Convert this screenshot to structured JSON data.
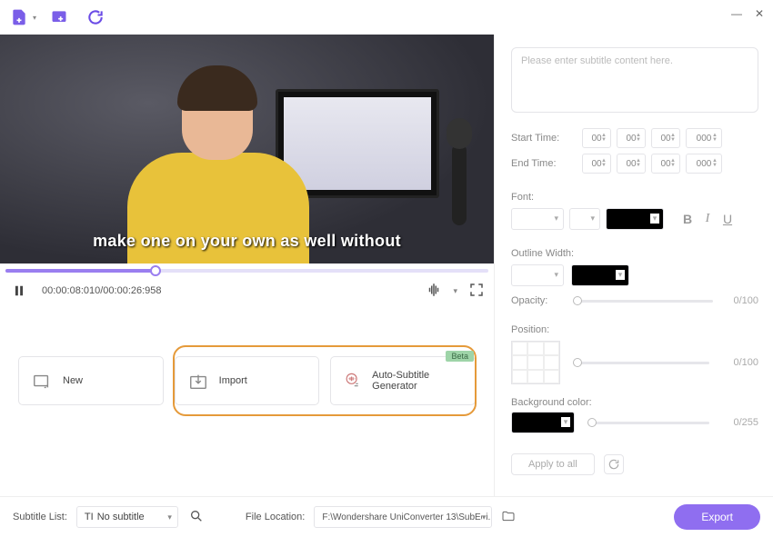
{
  "toolbar": {
    "icons": [
      "add-file-icon",
      "add-text-icon",
      "refresh-icon"
    ]
  },
  "video": {
    "burned_subtitle": "make one on your own as well without",
    "current_time": "00:00:08:010",
    "total_time": "00:00:26:958"
  },
  "actions": {
    "new": "New",
    "import": "Import",
    "auto": "Auto-Subtitle Generator",
    "beta": "Beta"
  },
  "panel": {
    "placeholder": "Please enter subtitle content here.",
    "start_label": "Start Time:",
    "end_label": "End Time:",
    "time_hh": "00",
    "time_mm": "00",
    "time_ss": "00",
    "time_ms": "000",
    "font_label": "Font:",
    "outline_label": "Outline Width:",
    "opacity_label": "Opacity:",
    "opacity_val": "0/100",
    "position_label": "Position:",
    "position_val": "0/100",
    "bg_label": "Background color:",
    "bg_val": "0/255",
    "apply_label": "Apply to all"
  },
  "bottom": {
    "sublist_label": "Subtitle List:",
    "sublist_value": "No subtitle",
    "fileloc_label": "File Location:",
    "fileloc_value": "F:\\Wondershare UniConverter 13\\SubEdi...",
    "export_label": "Export"
  }
}
